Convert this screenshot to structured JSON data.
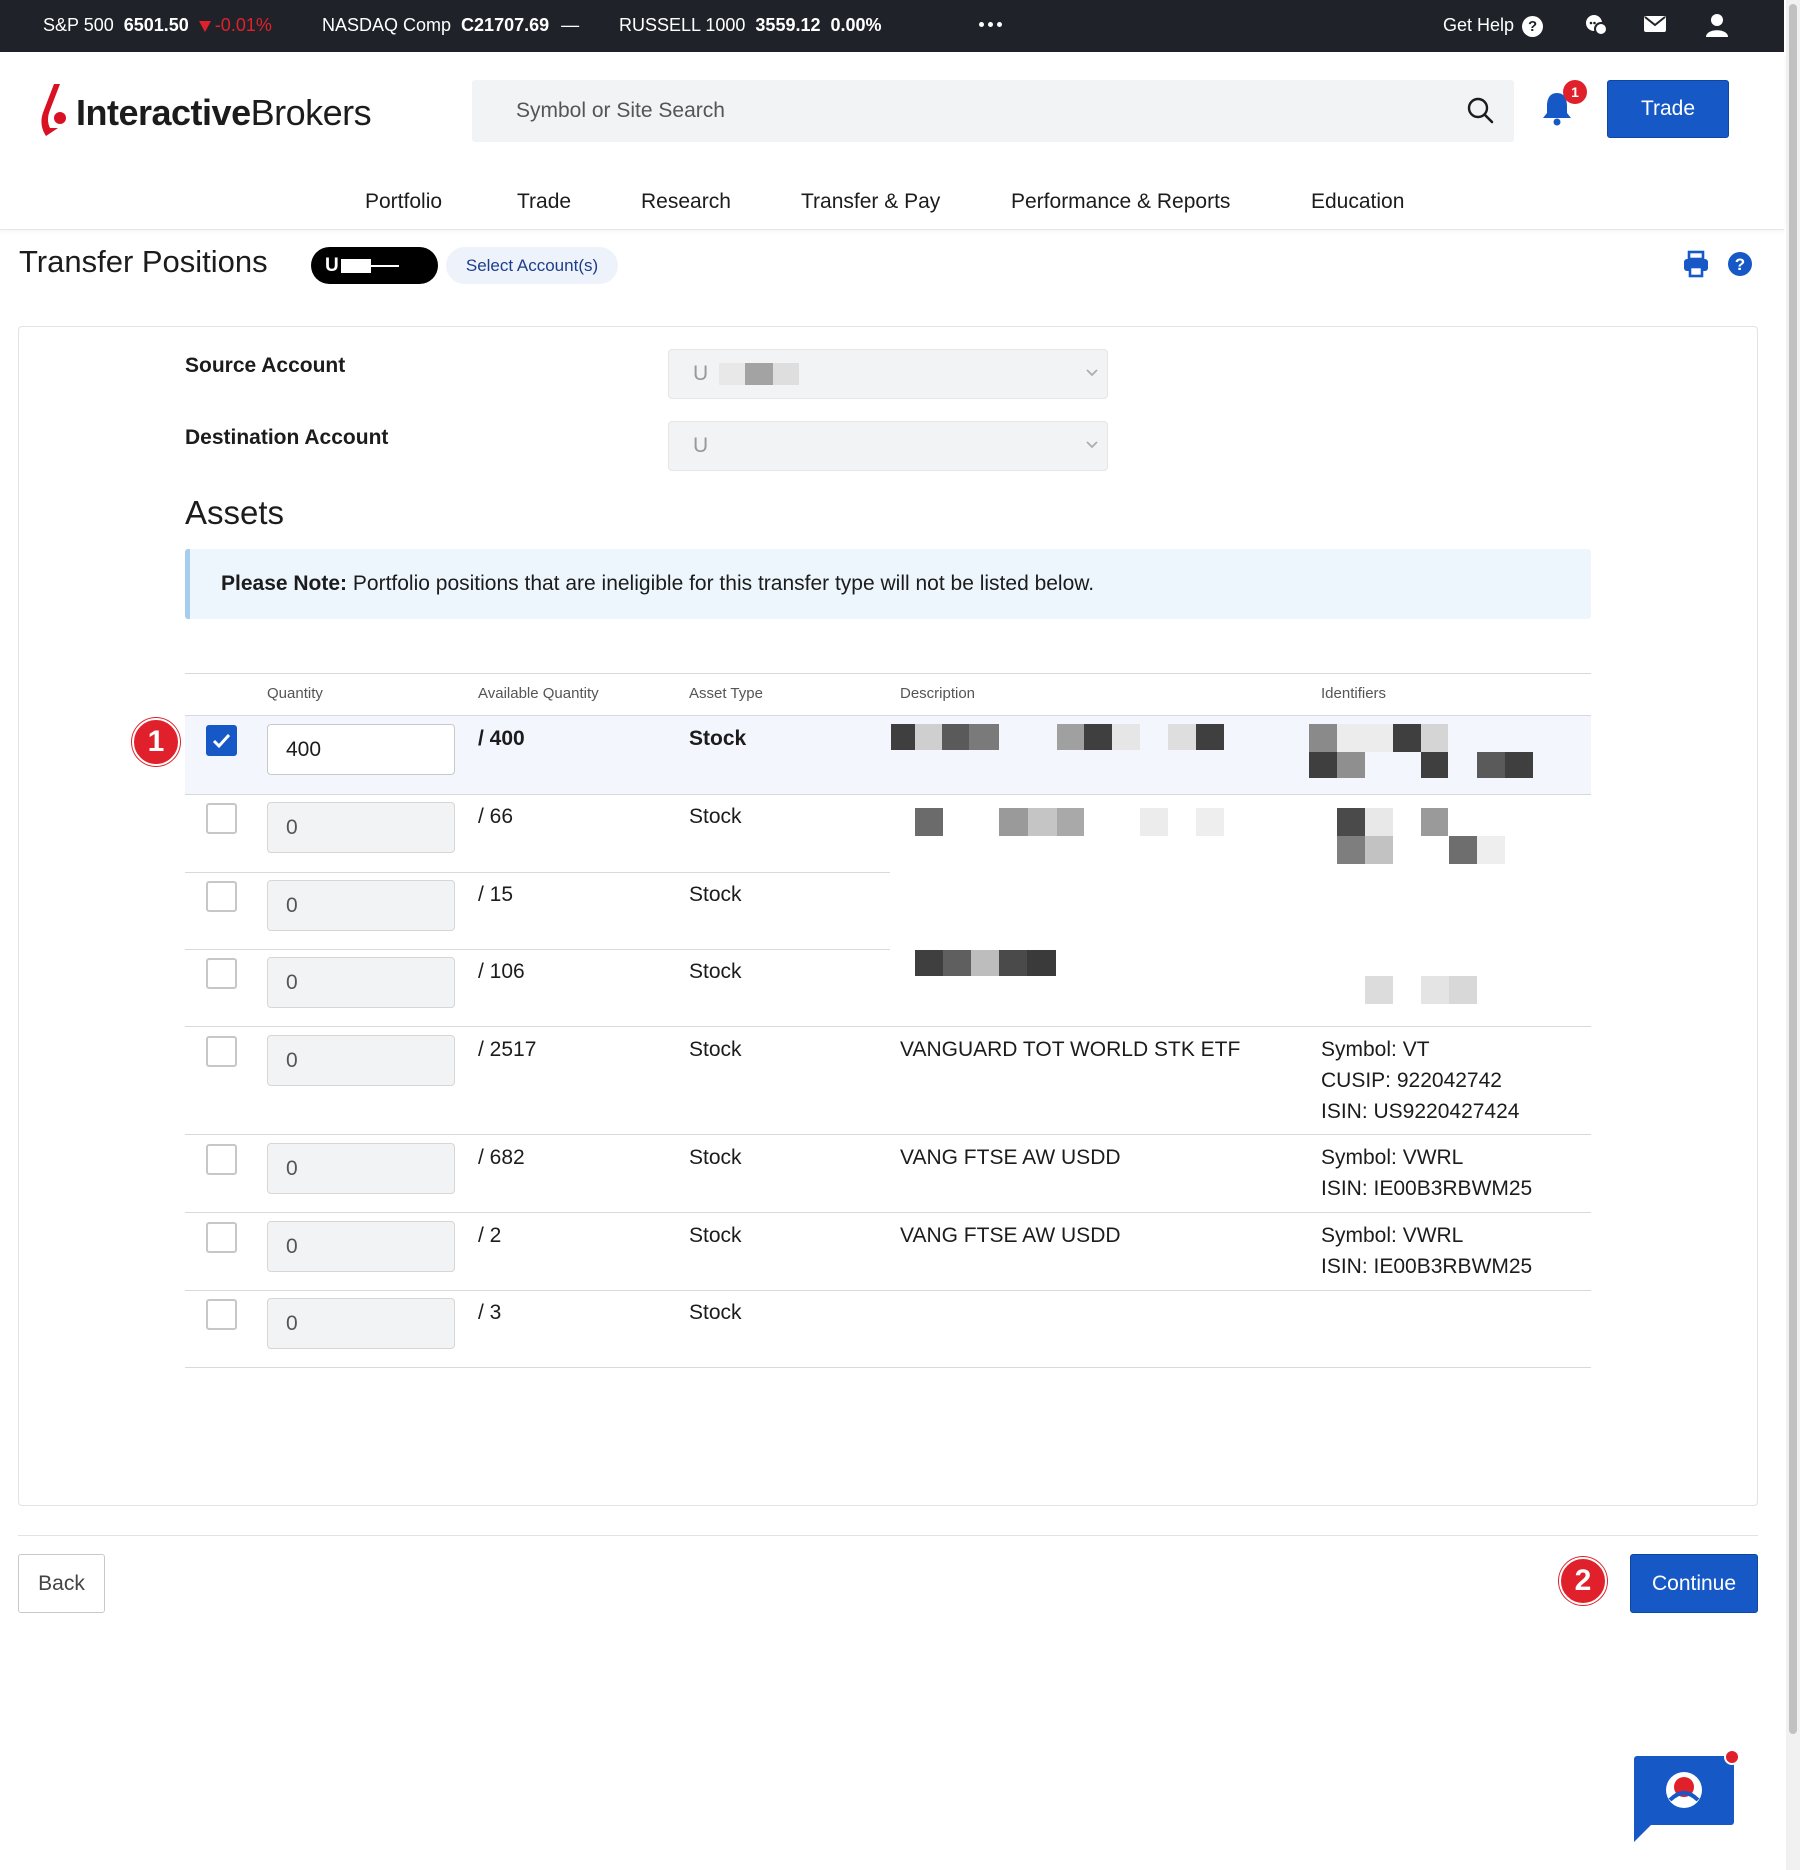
{
  "ticker": {
    "items": [
      {
        "name": "S&P 500",
        "value": "6501.50",
        "change": "-0.01%"
      },
      {
        "name": "NASDAQ Comp",
        "value": "C21707.69",
        "change": "—"
      },
      {
        "name": "RUSSELL 1000",
        "value": "3559.12",
        "change": "0.00%"
      }
    ],
    "get_help": "Get Help",
    "help_glyph": "?"
  },
  "header": {
    "logo_bold": "Interactive",
    "logo_light": "Brokers",
    "search_placeholder": "Symbol or Site Search",
    "notification_count": "1",
    "trade_label": "Trade"
  },
  "nav": [
    "Portfolio",
    "Trade",
    "Research",
    "Transfer & Pay",
    "Performance & Reports",
    "Education"
  ],
  "page": {
    "title": "Transfer Positions",
    "account_pill": "U",
    "select_accounts": "Select Account(s)",
    "help_glyph": "?"
  },
  "form": {
    "source_label": "Source Account",
    "source_value": "U",
    "destination_label": "Destination Account",
    "destination_value": "U"
  },
  "assets": {
    "heading": "Assets",
    "note_bold": "Please Note:",
    "note_text": " Portfolio positions that are ineligible for this transfer type will not be listed below."
  },
  "table": {
    "headers": [
      "Quantity",
      "Available Quantity",
      "Asset Type",
      "Description",
      "Identifiers"
    ],
    "rows": [
      {
        "checked": true,
        "quantity": "400",
        "available": "/ 400",
        "type": "Stock",
        "description": "",
        "identifiers": []
      },
      {
        "checked": false,
        "quantity": "0",
        "available": "/ 66",
        "type": "Stock",
        "description": "",
        "identifiers": []
      },
      {
        "checked": false,
        "quantity": "0",
        "available": "/ 15",
        "type": "Stock",
        "description": "",
        "identifiers": []
      },
      {
        "checked": false,
        "quantity": "0",
        "available": "/ 106",
        "type": "Stock",
        "description": "",
        "identifiers": []
      },
      {
        "checked": false,
        "quantity": "0",
        "available": "/ 2517",
        "type": "Stock",
        "description": "VANGUARD TOT WORLD STK ETF",
        "identifiers": [
          "Symbol: VT",
          "CUSIP: 922042742",
          "ISIN: US9220427424"
        ]
      },
      {
        "checked": false,
        "quantity": "0",
        "available": "/ 682",
        "type": "Stock",
        "description": "VANG FTSE AW USDD",
        "identifiers": [
          "Symbol: VWRL",
          "ISIN: IE00B3RBWM25"
        ]
      },
      {
        "checked": false,
        "quantity": "0",
        "available": "/ 2",
        "type": "Stock",
        "description": "VANG FTSE AW USDD",
        "identifiers": [
          "Symbol: VWRL",
          "ISIN: IE00B3RBWM25"
        ]
      },
      {
        "checked": false,
        "quantity": "0",
        "available": "/ 3",
        "type": "Stock",
        "description": "",
        "identifiers": []
      }
    ]
  },
  "markers": {
    "first": "1",
    "second": "2"
  },
  "footer": {
    "back_label": "Back",
    "continue_label": "Continue"
  },
  "colors": {
    "accent": "#1659c6",
    "ticker_bg": "#1f2329",
    "alert": "#e0202a",
    "note_bg": "#eef6fd"
  },
  "icons": [
    "logo-flame-icon",
    "search-icon",
    "bell-icon",
    "chat-bubbles-icon",
    "mail-icon",
    "user-icon",
    "printer-icon",
    "help-icon",
    "checkmark-icon",
    "chevron-down-icon",
    "chat-widget-icon"
  ]
}
